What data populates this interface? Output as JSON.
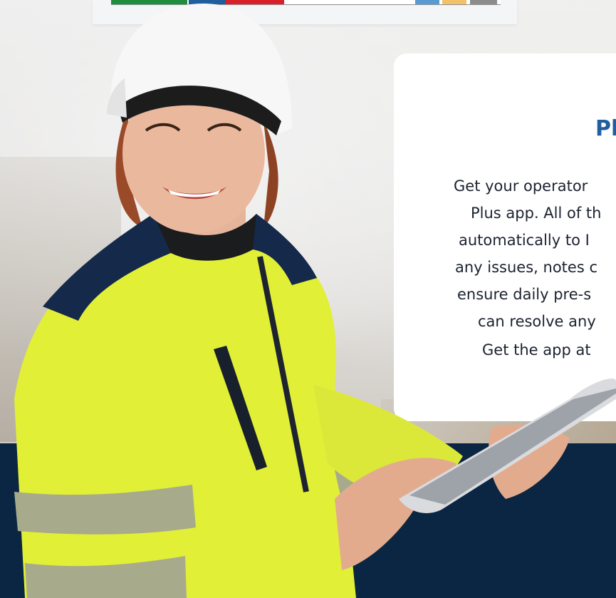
{
  "strip": {
    "segments": [
      {
        "color": "#1e8e3e",
        "width": 107
      },
      {
        "color": "#ffffff",
        "width": 2
      },
      {
        "color": "#1f5f9e",
        "width": 52
      },
      {
        "color": "#d9202a",
        "width": 82
      },
      {
        "color": "#ffffff",
        "width": 184
      },
      {
        "color": "#5a9ad2",
        "width": 34
      },
      {
        "color": "#ffffff",
        "width": 4
      },
      {
        "color": "#f2c26b",
        "width": 34
      },
      {
        "color": "#ffffff",
        "width": 5
      },
      {
        "color": "#8c8c8c",
        "width": 38
      }
    ]
  },
  "card": {
    "title": "Pl",
    "lines": [
      "Get your operator",
      "Plus app. All of th",
      "automatically to I",
      "any issues, notes c",
      "ensure daily pre-s",
      "can resolve any",
      "Get the app at"
    ]
  },
  "colors": {
    "navy": "#0b2642",
    "title_blue": "#1f5f9e",
    "jacket_yellow": "#e4f23a"
  }
}
